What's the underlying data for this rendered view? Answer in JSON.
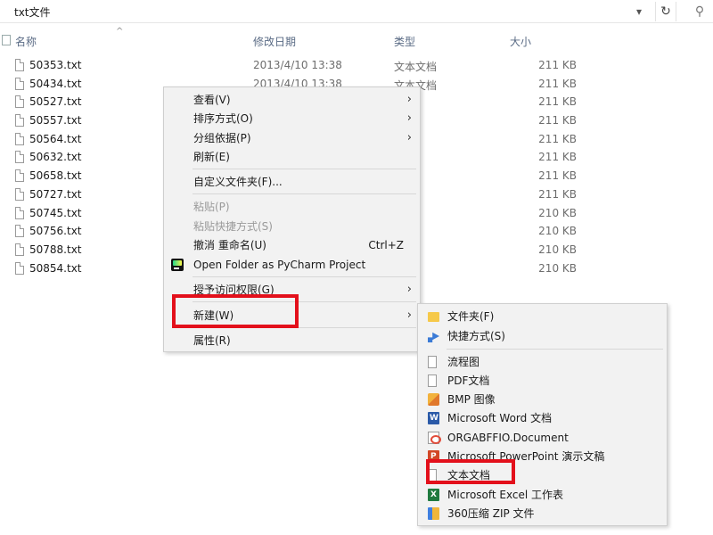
{
  "address": {
    "path": "txt文件"
  },
  "columns": {
    "name": "名称",
    "date": "修改日期",
    "type": "类型",
    "size": "大小"
  },
  "files": [
    {
      "name": "50353.txt",
      "date": "2013/4/10 13:38",
      "type": "文本文档",
      "size": "211 KB"
    },
    {
      "name": "50434.txt",
      "date": "2013/4/10 13:38",
      "type": "文本文档",
      "size": "211 KB"
    },
    {
      "name": "50527.txt",
      "date": "",
      "type": "档",
      "size": "211 KB"
    },
    {
      "name": "50557.txt",
      "date": "",
      "type": "档",
      "size": "211 KB"
    },
    {
      "name": "50564.txt",
      "date": "",
      "type": "档",
      "size": "211 KB"
    },
    {
      "name": "50632.txt",
      "date": "",
      "type": "档",
      "size": "211 KB"
    },
    {
      "name": "50658.txt",
      "date": "",
      "type": "档",
      "size": "211 KB"
    },
    {
      "name": "50727.txt",
      "date": "",
      "type": "档",
      "size": "211 KB"
    },
    {
      "name": "50745.txt",
      "date": "",
      "type": "档",
      "size": "210 KB"
    },
    {
      "name": "50756.txt",
      "date": "",
      "type": "档",
      "size": "210 KB"
    },
    {
      "name": "50788.txt",
      "date": "",
      "type": "档",
      "size": "210 KB"
    },
    {
      "name": "50854.txt",
      "date": "",
      "type": "档",
      "size": "210 KB"
    }
  ],
  "context_menu": {
    "view": "查看(V)",
    "sort": "排序方式(O)",
    "group": "分组依据(P)",
    "refresh": "刷新(E)",
    "customize": "自定义文件夹(F)...",
    "paste": "粘贴(P)",
    "paste_shortcut": "粘贴快捷方式(S)",
    "undo": "撤消 重命名(U)",
    "undo_shortcut": "Ctrl+Z",
    "pycharm": "Open Folder as PyCharm Project",
    "access": "授予访问权限(G)",
    "new": "新建(W)",
    "properties": "属性(R)"
  },
  "new_submenu": {
    "folder": "文件夹(F)",
    "shortcut": "快捷方式(S)",
    "flowchart": "流程图",
    "pdf": "PDF文档",
    "bmp": "BMP 图像",
    "word": "Microsoft Word 文档",
    "orga": "ORGABFFIO.Document",
    "ppt": "Microsoft PowerPoint 演示文稿",
    "text": "文本文档",
    "excel": "Microsoft Excel 工作表",
    "zip": "360压缩 ZIP 文件"
  },
  "icons": {
    "dropdown": "▾",
    "refresh": "↻",
    "search": "⚲",
    "sort": "^",
    "arrow": "›"
  },
  "colors": {
    "highlight": "#e3101b",
    "menu_bg": "#f2f2f2"
  }
}
